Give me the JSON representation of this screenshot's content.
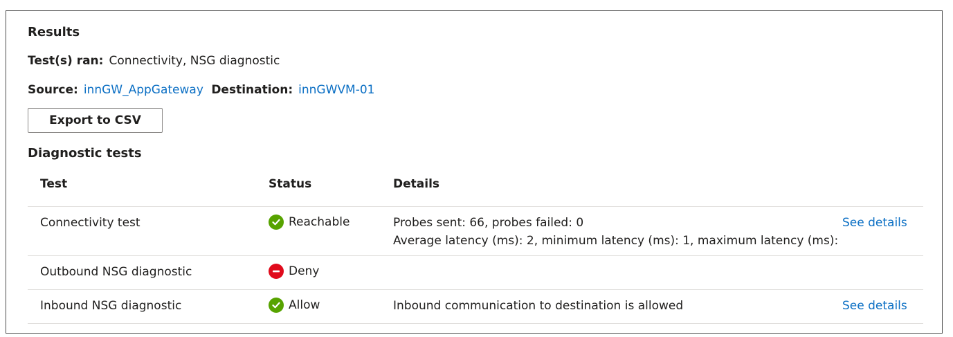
{
  "results": {
    "title": "Results",
    "tests_ran_label": "Test(s) ran:",
    "tests_ran_value": "Connectivity, NSG diagnostic",
    "source_label": "Source:",
    "source_value": "innGW_AppGateway",
    "destination_label": "Destination:",
    "destination_value": "innGWVM-01",
    "export_label": "Export to CSV"
  },
  "diagnostics": {
    "title": "Diagnostic tests",
    "columns": {
      "test": "Test",
      "status": "Status",
      "details": "Details"
    },
    "rows": [
      {
        "test": "Connectivity test",
        "status": "Reachable",
        "status_icon": "check-circle-icon",
        "details_line1": "Probes sent: 66, probes failed: 0",
        "details_line2": "Average latency (ms): 2, minimum latency (ms): 1, maximum latency (ms):",
        "link": "See details"
      },
      {
        "test": "Outbound NSG diagnostic",
        "status": "Deny",
        "status_icon": "deny-icon",
        "details_line1": "",
        "link": ""
      },
      {
        "test": "Inbound NSG diagnostic",
        "status": "Allow",
        "status_icon": "check-circle-icon",
        "details_line1": "Inbound communication to destination is allowed",
        "link": "See details"
      }
    ]
  },
  "colors": {
    "link": "#0b6fc4",
    "success": "#57a300",
    "deny": "#e00b1c",
    "border": "#4a4a4a",
    "row_divider": "#e1dfdd"
  }
}
